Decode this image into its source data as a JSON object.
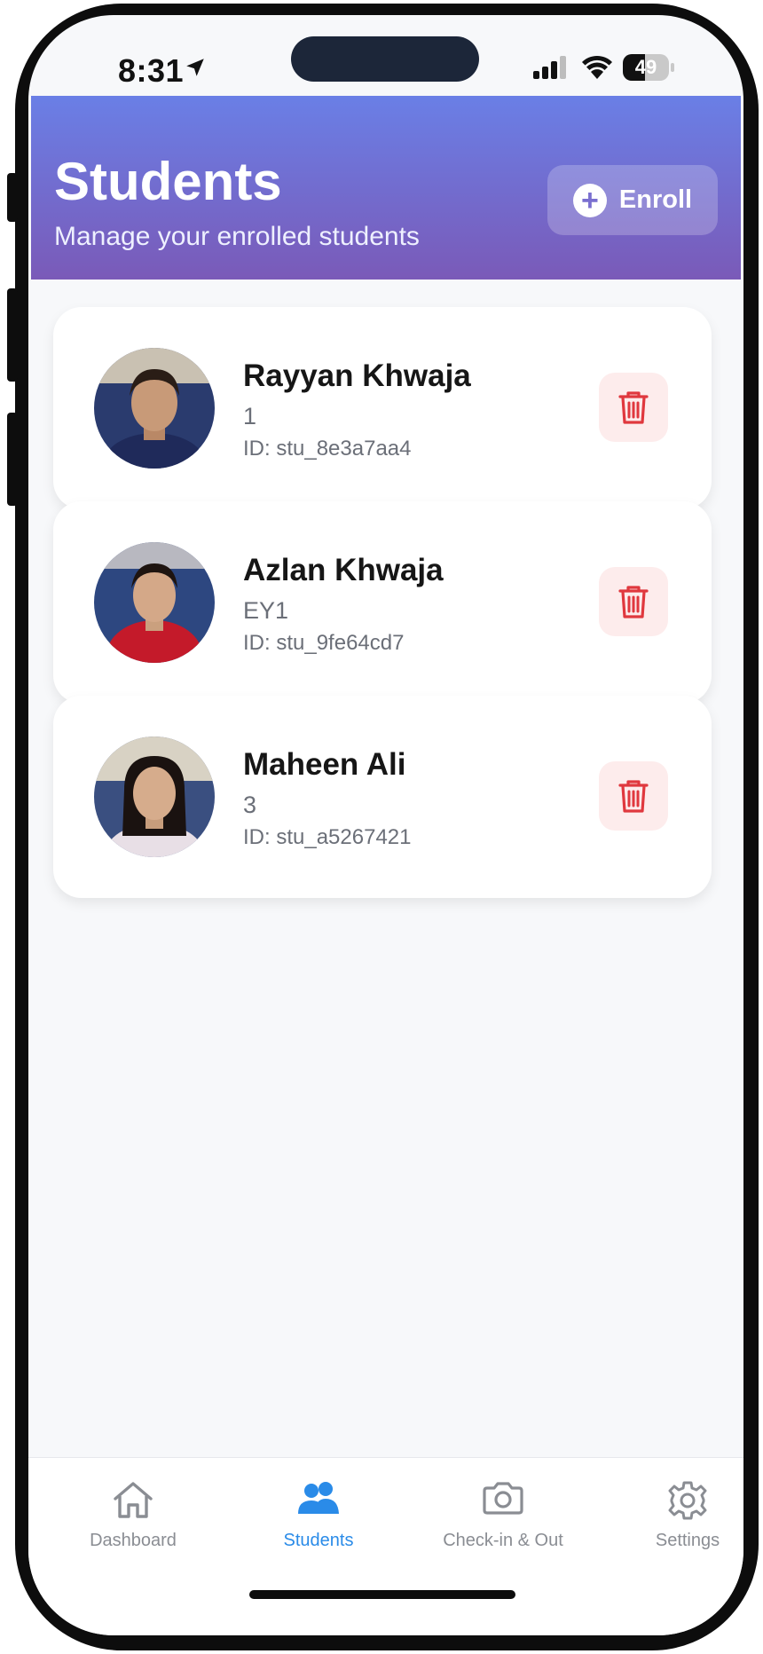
{
  "status_bar": {
    "time": "8:31",
    "battery": "49",
    "battery_level": 0.49
  },
  "header": {
    "title": "Students",
    "subtitle": "Manage your enrolled students",
    "enroll_label": "Enroll"
  },
  "students": [
    {
      "name": "Rayyan Khwaja",
      "grade": "1",
      "id": "ID: stu_8e3a7aa4",
      "avatar_bg": "#2a3b6e",
      "shirt": "#1f2a5a",
      "hair": "#2a1d16"
    },
    {
      "name": "Azlan Khwaja",
      "grade": "EY1",
      "id": "ID: stu_9fe64cd7",
      "avatar_bg": "#2d4780",
      "shirt": "#c41a2a",
      "hair": "#1e1410"
    },
    {
      "name": "Maheen Ali",
      "grade": "3",
      "id": "ID: stu_a5267421",
      "avatar_bg": "#3a4f80",
      "shirt": "#e8dfe6",
      "hair": "#1a1210"
    }
  ],
  "tabs": [
    {
      "label": "Dashboard",
      "icon": "home-icon"
    },
    {
      "label": "Students",
      "icon": "users-icon"
    },
    {
      "label": "Check-in & Out",
      "icon": "camera-icon"
    },
    {
      "label": "Settings",
      "icon": "gear-icon"
    }
  ],
  "colors": {
    "header_top": "#6a7fe6",
    "header_bottom": "#7a5ab8",
    "active_tab": "#2a8be8",
    "delete_red": "#e0383e",
    "delete_bg": "#fdecec"
  }
}
